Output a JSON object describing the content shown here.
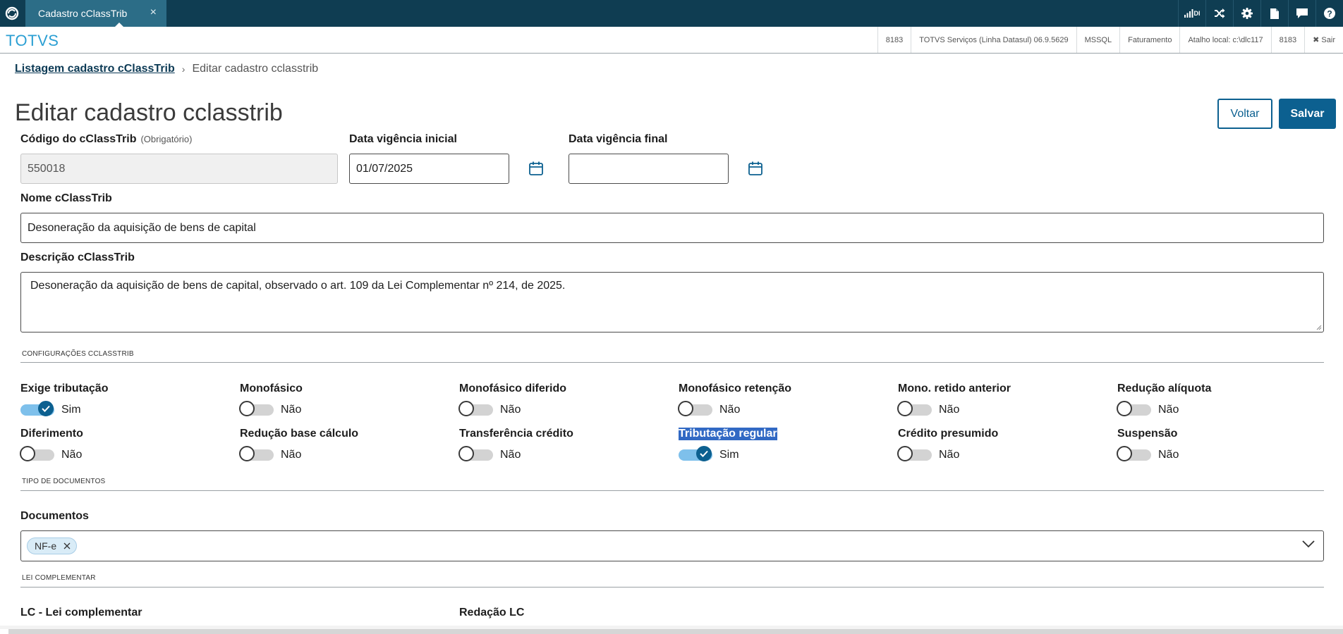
{
  "tab": {
    "title": "Cadastro cClassTrib",
    "close": "×"
  },
  "topbar": {
    "di": "DI"
  },
  "brand": "TOTVS",
  "info": [
    "8183",
    "TOTVS Serviços (Linha Datasul) 06.9.5629",
    "MSSQL",
    "Faturamento",
    "Atalho local: c:\\dlc117",
    "8183",
    "✖ Sair"
  ],
  "breadcrumb": {
    "parent": "Listagem cadastro cClassTrib",
    "sep": "›",
    "current": "Editar cadastro cclasstrib"
  },
  "title": "Editar cadastro cclasstrib",
  "buttons": {
    "back": "Voltar",
    "save": "Salvar"
  },
  "form": {
    "codigo": {
      "label": "Código do cClassTrib",
      "optional": "(Obrigatório)",
      "value": "550018"
    },
    "inicio": {
      "label": "Data vigência inicial",
      "value": "01/07/2025"
    },
    "final": {
      "label": "Data vigência final",
      "value": ""
    },
    "nome": {
      "label": "Nome cClassTrib",
      "value": "Desoneração da aquisição de bens de capital"
    },
    "descricao": {
      "label": "Descrição cClassTrib",
      "value": "Desoneração da aquisição de bens de capital, observado o art. 109 da Lei Complementar nº 214, de 2025."
    }
  },
  "sections": {
    "config": "CONFIGURAÇÕES CCLASSTRIB",
    "tipo": "TIPO DE DOCUMENTOS",
    "lei": "LEI COMPLEMENTAR"
  },
  "switches": [
    {
      "label": "Exige tributação",
      "text": "Sim",
      "on": true
    },
    {
      "label": "Monofásico",
      "text": "Não",
      "on": false
    },
    {
      "label": "Monofásico diferido",
      "text": "Não",
      "on": false
    },
    {
      "label": "Monofásico retenção",
      "text": "Não",
      "on": false
    },
    {
      "label": "Mono. retido anterior",
      "text": "Não",
      "on": false
    },
    {
      "label": "Redução alíquota",
      "text": "Não",
      "on": false
    },
    {
      "label": "Diferimento",
      "text": "Não",
      "on": false
    },
    {
      "label": "Redução base cálculo",
      "text": "Não",
      "on": false
    },
    {
      "label": "Transferência crédito",
      "text": "Não",
      "on": false
    },
    {
      "label": "Tributação regular",
      "text": "Sim",
      "on": true
    },
    {
      "label": "Crédito presumido",
      "text": "Não",
      "on": false
    },
    {
      "label": "Suspensão",
      "text": "Não",
      "on": false
    }
  ],
  "documentos": {
    "label": "Documentos",
    "chip": "NF-e"
  },
  "lc": {
    "label1": "LC - Lei complementar",
    "label2": "Redação LC"
  },
  "colors": {
    "topbar": "#0f3d52",
    "tab": "#2c6d87",
    "primary": "#0c6090",
    "brand": "#2b9fd3",
    "toggle_on": "#7ec0eb",
    "selection": "#3169c4"
  }
}
